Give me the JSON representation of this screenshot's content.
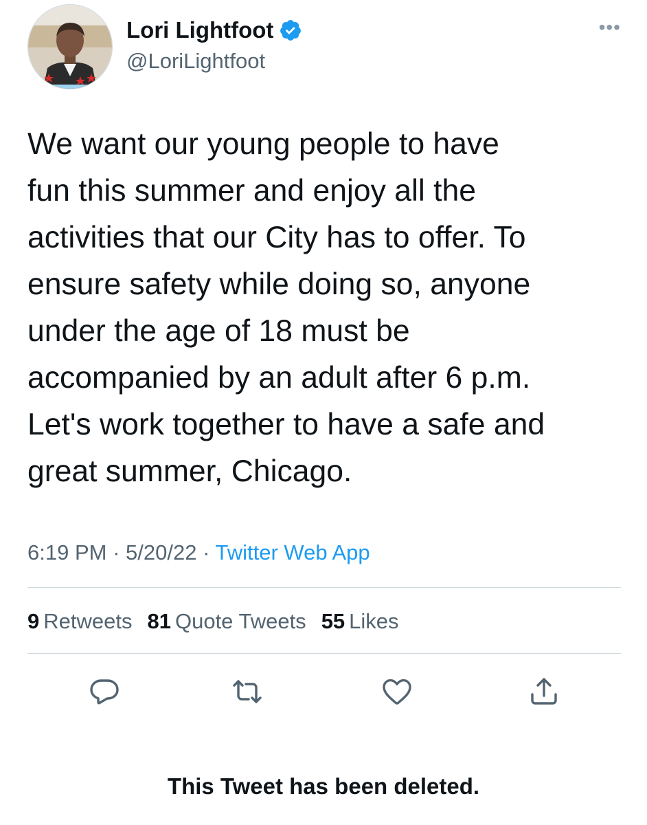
{
  "author": {
    "display_name": "Lori Lightfoot",
    "handle": "@LoriLightfoot",
    "verified_icon": "verified-badge-icon",
    "avatar_icon": "profile-photo"
  },
  "more_menu": {
    "label": "•••",
    "icon": "more-options-icon"
  },
  "tweet": {
    "text": "We want our young people to have\nfun this summer and enjoy all the\nactivities that our City has to offer. To\nensure safety while doing so, anyone\nunder the age of 18 must be\naccompanied by an adult after 6 p.m.\nLet's work together to have a safe and\ngreat summer, Chicago.",
    "time": "6:19 PM",
    "separator": "·",
    "date": "5/20/22",
    "source": "Twitter Web App"
  },
  "stats": {
    "retweets": {
      "count": "9",
      "label": "Retweets"
    },
    "quotes": {
      "count": "81",
      "label": "Quote Tweets"
    },
    "likes": {
      "count": "55",
      "label": "Likes"
    }
  },
  "actions": [
    {
      "icon": "reply-icon"
    },
    {
      "icon": "retweet-icon"
    },
    {
      "icon": "like-icon"
    },
    {
      "icon": "share-icon"
    }
  ],
  "notice": "This Tweet has been deleted.",
  "colors": {
    "text": "#0f1419",
    "secondary": "#536471",
    "accent": "#1d9bf0",
    "divider": "#cfd9de"
  }
}
